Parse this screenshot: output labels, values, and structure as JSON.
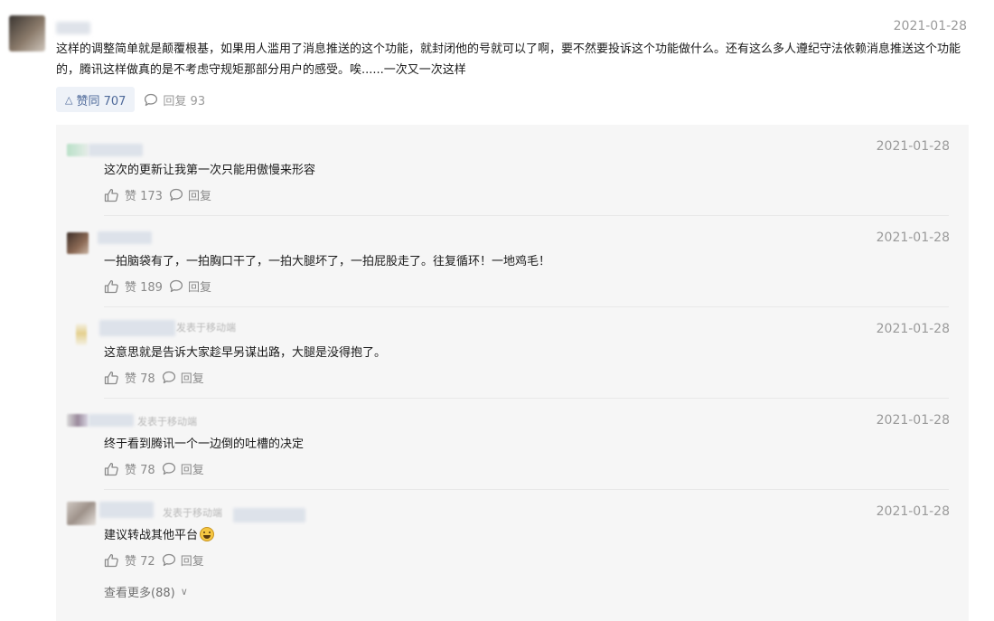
{
  "main_comment": {
    "date": "2021-01-28",
    "text": "这样的调整简单就是颠覆根基，如果用人滥用了消息推送的这个功能，就封闭他的号就可以了啊，要不然要投诉这个功能做什么。还有这么多人遵纪守法依赖消息推送这个功能的，腾讯这样做真的是不考虑守规矩那部分用户的感受。唉......一次又一次这样",
    "agree_label": "赞同 707",
    "reply_label": "回复 93"
  },
  "replies": [
    {
      "date": "2021-01-28",
      "text": "这次的更新让我第一次只能用傲慢来形容",
      "like_label": "赞 173",
      "reply_label": "回复",
      "from_label": ""
    },
    {
      "date": "2021-01-28",
      "text": "一拍脑袋有了，一拍胸口干了，一拍大腿坏了，一拍屁股走了。往复循环！一地鸡毛！",
      "like_label": "赞 189",
      "reply_label": "回复",
      "from_label": ""
    },
    {
      "date": "2021-01-28",
      "text": "这意思就是告诉大家趁早另谋出路，大腿是没得抱了。",
      "like_label": "赞 78",
      "reply_label": "回复",
      "from_label": "发表于移动端"
    },
    {
      "date": "2021-01-28",
      "text": "终于看到腾讯一个一边倒的吐槽的决定",
      "like_label": "赞 78",
      "reply_label": "回复",
      "from_label": "发表于移动端"
    },
    {
      "date": "2021-01-28",
      "text": "建议转战其他平台",
      "like_label": "赞 72",
      "reply_label": "回复",
      "from_label": "发表于移动端"
    }
  ],
  "more_label": "查看更多(88)",
  "icons": {
    "like": "thumb-up-icon",
    "reply": "speech-bubble-icon",
    "agree": "triangle-up-icon",
    "more": "chevron-down-icon",
    "emoji": "grinning-emoji-icon"
  },
  "colors": {
    "agree_bg": "#eef2f8",
    "agree_text": "#4f6a9a",
    "reply_area_bg": "#f6f6f6",
    "muted_text": "#9a9a9a"
  }
}
